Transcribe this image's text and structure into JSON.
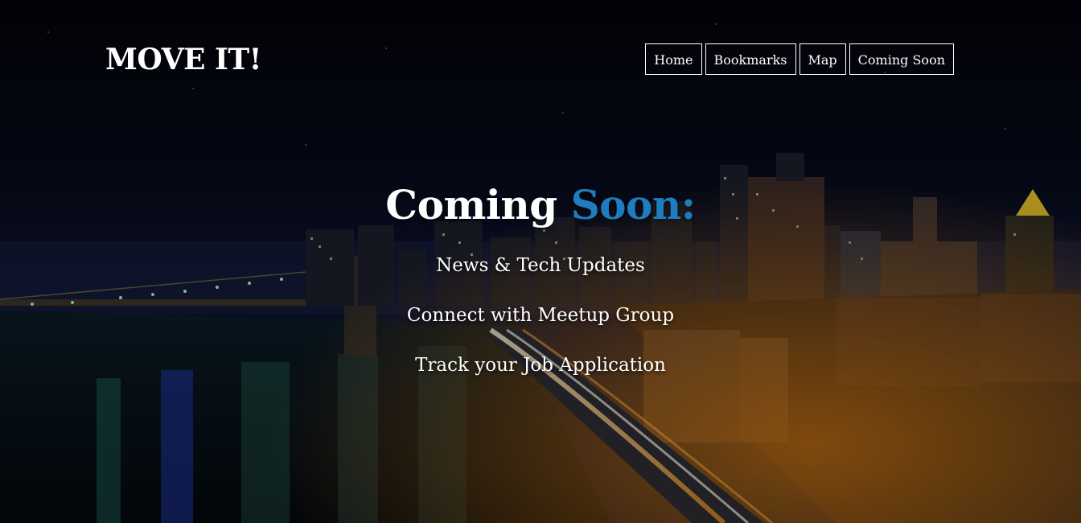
{
  "header": {
    "logo": "MOVE IT!"
  },
  "nav": {
    "items": [
      {
        "label": "Home"
      },
      {
        "label": "Bookmarks"
      },
      {
        "label": "Map"
      },
      {
        "label": "Coming Soon"
      }
    ]
  },
  "hero": {
    "title_part1": "Coming",
    "title_part2": "Soon:",
    "features": [
      "News & Tech Updates",
      "Connect with Meetup Group",
      "Track your Job Application"
    ]
  },
  "colors": {
    "accent": "#1f7dbf",
    "text": "#ffffff",
    "background": "#05070f"
  }
}
